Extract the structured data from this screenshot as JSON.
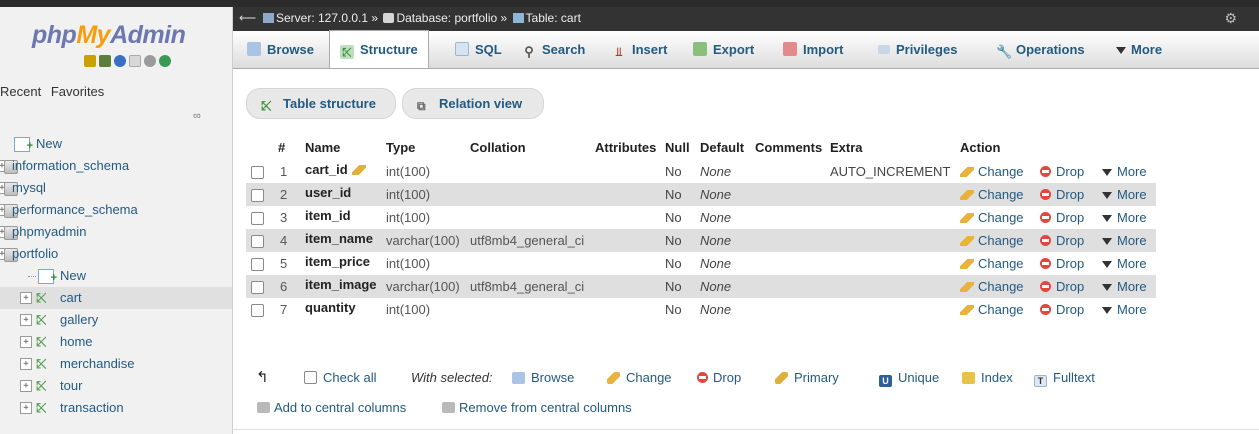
{
  "app": {
    "logo_php": "php",
    "logo_my": "My",
    "logo_admin": "Admin"
  },
  "nav": {
    "tabs": [
      "Recent",
      "Favorites"
    ],
    "tree": [
      {
        "label": "New",
        "kind": "new",
        "indent": 0
      },
      {
        "label": "information_schema",
        "kind": "db",
        "indent": 0
      },
      {
        "label": "mysql",
        "kind": "db",
        "indent": 0
      },
      {
        "label": "performance_schema",
        "kind": "db",
        "indent": 0
      },
      {
        "label": "phpmyadmin",
        "kind": "db",
        "indent": 0
      },
      {
        "label": "portfolio",
        "kind": "db",
        "indent": 0
      },
      {
        "label": "New",
        "kind": "new",
        "indent": 1
      },
      {
        "label": "cart",
        "kind": "table",
        "indent": 1,
        "selected": true
      },
      {
        "label": "gallery",
        "kind": "table",
        "indent": 1
      },
      {
        "label": "home",
        "kind": "table",
        "indent": 1
      },
      {
        "label": "merchandise",
        "kind": "table",
        "indent": 1
      },
      {
        "label": "tour",
        "kind": "table",
        "indent": 1
      },
      {
        "label": "transaction",
        "kind": "table",
        "indent": 1
      }
    ]
  },
  "breadcrumb": {
    "server": "Server: 127.0.0.1",
    "database": "Database: portfolio",
    "table": "Table: cart",
    "separator": "»"
  },
  "menu": {
    "tabs": [
      "Browse",
      "Structure",
      "SQL",
      "Search",
      "Insert",
      "Export",
      "Import",
      "Privileges",
      "Operations",
      "More"
    ],
    "active": "Structure"
  },
  "subtabs": [
    "Table structure",
    "Relation view"
  ],
  "table": {
    "headers": [
      "#",
      "Name",
      "Type",
      "Collation",
      "Attributes",
      "Null",
      "Default",
      "Comments",
      "Extra",
      "Action"
    ],
    "rows": [
      {
        "num": "1",
        "name": "cart_id",
        "type": "int(100)",
        "collation": "",
        "null": "No",
        "default": "None",
        "extra": "AUTO_INCREMENT",
        "primary": true
      },
      {
        "num": "2",
        "name": "user_id",
        "type": "int(100)",
        "collation": "",
        "null": "No",
        "default": "None",
        "extra": ""
      },
      {
        "num": "3",
        "name": "item_id",
        "type": "int(100)",
        "collation": "",
        "null": "No",
        "default": "None",
        "extra": ""
      },
      {
        "num": "4",
        "name": "item_name",
        "type": "varchar(100)",
        "collation": "utf8mb4_general_ci",
        "null": "No",
        "default": "None",
        "extra": ""
      },
      {
        "num": "5",
        "name": "item_price",
        "type": "int(100)",
        "collation": "",
        "null": "No",
        "default": "None",
        "extra": ""
      },
      {
        "num": "6",
        "name": "item_image",
        "type": "varchar(100)",
        "collation": "utf8mb4_general_ci",
        "null": "No",
        "default": "None",
        "extra": ""
      },
      {
        "num": "7",
        "name": "quantity",
        "type": "int(100)",
        "collation": "",
        "null": "No",
        "default": "None",
        "extra": ""
      }
    ],
    "actions": [
      "Change",
      "Drop",
      "More"
    ]
  },
  "bulk": {
    "check_all": "Check all",
    "with_selected": "With selected:",
    "actions": [
      "Browse",
      "Change",
      "Drop",
      "Primary",
      "Unique",
      "Index",
      "Fulltext"
    ],
    "add_central": "Add to central columns",
    "remove_central": "Remove from central columns"
  },
  "colors": {
    "link": "#235a81",
    "drop": "#e2463f",
    "row_alt": "#dfdfdf",
    "logo_blue": "#6c78af",
    "logo_orange": "#f89c0e"
  }
}
